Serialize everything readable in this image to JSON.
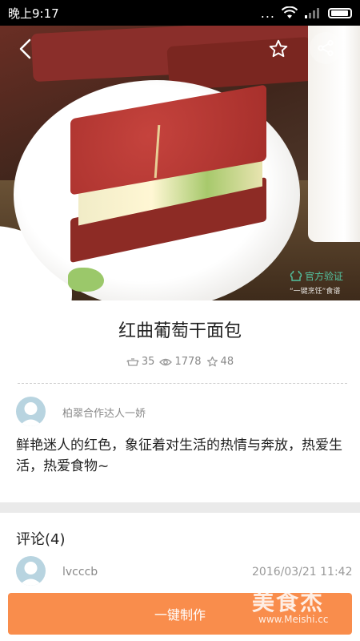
{
  "status_bar": {
    "time": "晚上9:17",
    "dots": "...",
    "icons": [
      "wifi-icon",
      "signal-icon",
      "battery-icon"
    ]
  },
  "hero": {
    "verified_label": "官方验证",
    "verified_sub": "“一键烹饪”食谱"
  },
  "recipe": {
    "title": "红曲葡萄干面包",
    "stats": {
      "made_count": "35",
      "view_count": "1778",
      "fav_count": "48"
    },
    "author": "柏翠合作达人一娇",
    "description": "鲜艳迷人的红色，象征着对生活的热情与奔放，热爱生活，热爱食物~"
  },
  "comments": {
    "title": "评论(4)",
    "items": [
      {
        "user": "lvcccb",
        "date": "2016/03/21 11:42"
      }
    ]
  },
  "action": {
    "make_label": "一键制作"
  },
  "watermark": {
    "main": "美食杰",
    "sub": "www.Meishi.cc"
  },
  "colors": {
    "accent": "#f98d4c",
    "verified": "#53c4a1",
    "avatar": "#b8d4e0"
  }
}
